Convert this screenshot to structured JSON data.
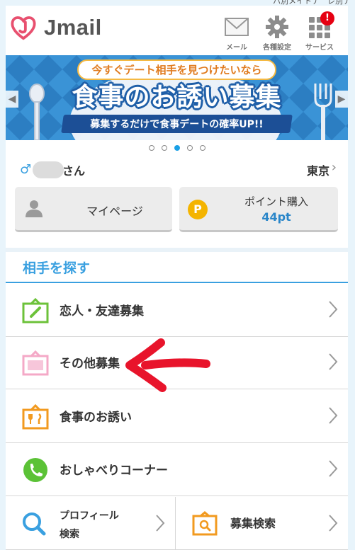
{
  "header": {
    "logo_text": "Jmail",
    "nav": [
      {
        "label": "メール",
        "icon": "mail-icon"
      },
      {
        "label": "各種設定",
        "icon": "gear-icon"
      },
      {
        "label": "サービス",
        "icon": "grid-icon",
        "badge": "!"
      }
    ]
  },
  "banner": {
    "top_line": "今すぐデート相手を見つけたいなら",
    "title": "食事のお誘い募集",
    "subtitle": "募集するだけで食事デートの確率UP!!",
    "slides": 5,
    "active_slide": 3
  },
  "user": {
    "gender_symbol": "♂",
    "name_suffix": "さん",
    "area": "東京"
  },
  "buttons": {
    "mypage": "マイページ",
    "points_title": "ポイント購入",
    "points_value": "44pt",
    "points_icon_letter": "P"
  },
  "section": {
    "title": "相手を探す"
  },
  "menu": {
    "items": [
      {
        "label": "恋人・友達募集",
        "icon": "love-friend-board-icon",
        "color": "#6cc23a"
      },
      {
        "label": "その他募集",
        "icon": "other-board-icon",
        "color": "#f4a9c7"
      },
      {
        "label": "食事のお誘い",
        "icon": "meal-board-icon",
        "color": "#f29a1f"
      },
      {
        "label": "おしゃべりコーナー",
        "icon": "phone-icon",
        "color": "#5bc236"
      }
    ],
    "profile_search": [
      "プロフィール",
      "検索"
    ],
    "recruit_search": "募集検索"
  },
  "colors": {
    "accent": "#3aa0e0",
    "badge": "#e60012",
    "points_value": "#2a86c9",
    "annotation_arrow": "#e8142b"
  }
}
